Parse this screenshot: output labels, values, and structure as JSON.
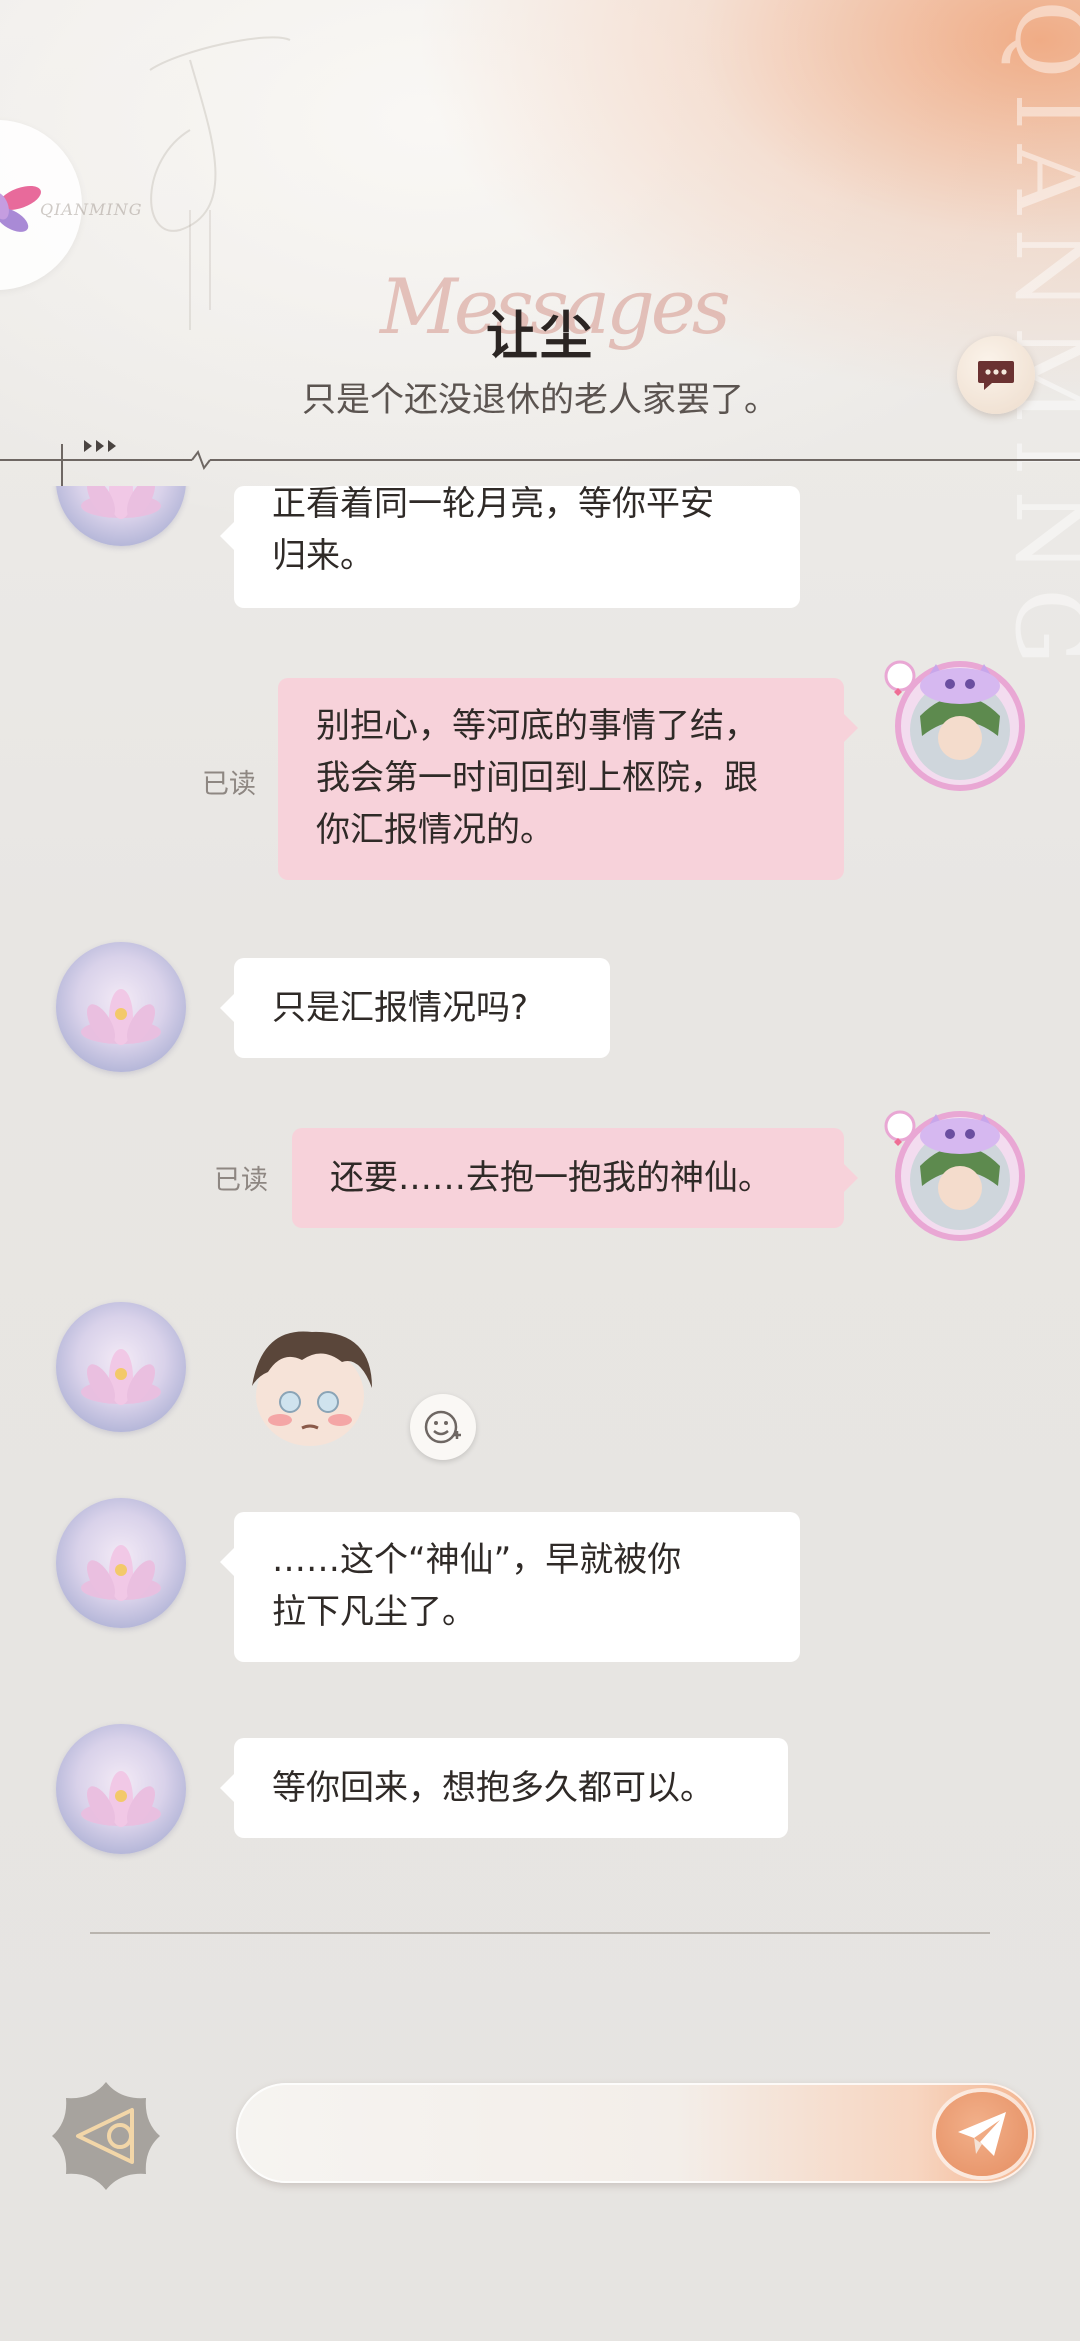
{
  "header": {
    "title": "让尘",
    "subtitle": "只是个还没退休的老人家罢了。",
    "script_text": "Messages",
    "logo_text": "QIANMING",
    "deco_letters": "QIANMING"
  },
  "messages": [
    {
      "side": "left",
      "avatar": "lotus-avatar",
      "text": "正看着同一轮月亮，等你平安\n归来。"
    },
    {
      "side": "right",
      "avatar": "green-hair-cat-avatar",
      "status": "已读",
      "text": "别担心，等河底的事情了结，\n我会第一时间回到上枢院，跟\n你汇报情况的。"
    },
    {
      "side": "left",
      "avatar": "lotus-avatar",
      "text": "只是汇报情况吗?"
    },
    {
      "side": "right",
      "avatar": "green-hair-cat-avatar",
      "status": "已读",
      "text": "还要……去抱一抱我的神仙。"
    },
    {
      "side": "left",
      "avatar": "lotus-avatar",
      "type": "sticker",
      "sticker": "blushing-chibi-sticker"
    },
    {
      "side": "left",
      "avatar": "lotus-avatar",
      "text": "……这个“神仙”，早就被你\n拉下凡尘了。"
    },
    {
      "side": "left",
      "avatar": "lotus-avatar",
      "text": "等你回来，想抱多久都可以。"
    }
  ],
  "input": {
    "value": "",
    "placeholder": ""
  },
  "icons": {
    "chat": "chat-bubble-icon",
    "react": "emoji-add-icon",
    "back": "back-triangle-icon",
    "send": "paper-plane-icon"
  },
  "colors": {
    "accent": "#e58e62",
    "bubble_right": "#f7d2da",
    "bubble_left": "#ffffff",
    "background": "#e8e6e3"
  }
}
